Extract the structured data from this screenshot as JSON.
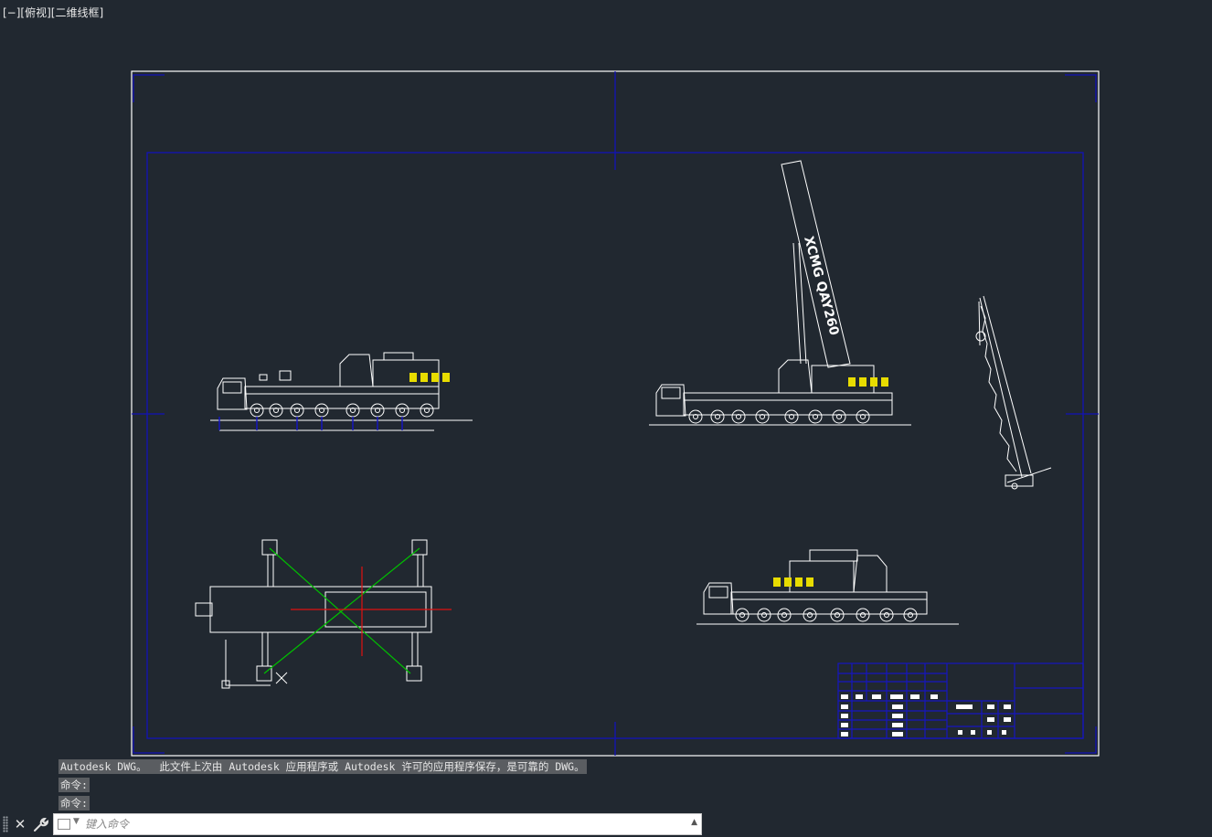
{
  "viewport": {
    "label": "[−][俯视][二维线框]"
  },
  "drawing": {
    "boom_text": "XCMG QAY260"
  },
  "command_history": [
    "Autodesk DWG。  此文件上次由 Autodesk 应用程序或 Autodesk 许可的应用程序保存，是可靠的 DWG。",
    "命令:",
    "命令:"
  ],
  "command_bar": {
    "placeholder": "键入命令",
    "close_icon": "close-icon",
    "customize_icon": "wrench-icon"
  },
  "colors": {
    "background": "#212830",
    "sheet_border": "#ffffff",
    "frame_blue": "#1010b0",
    "guide_green": "#00c000",
    "center_red": "#e01010",
    "hazard_yellow": "#f0e000"
  }
}
